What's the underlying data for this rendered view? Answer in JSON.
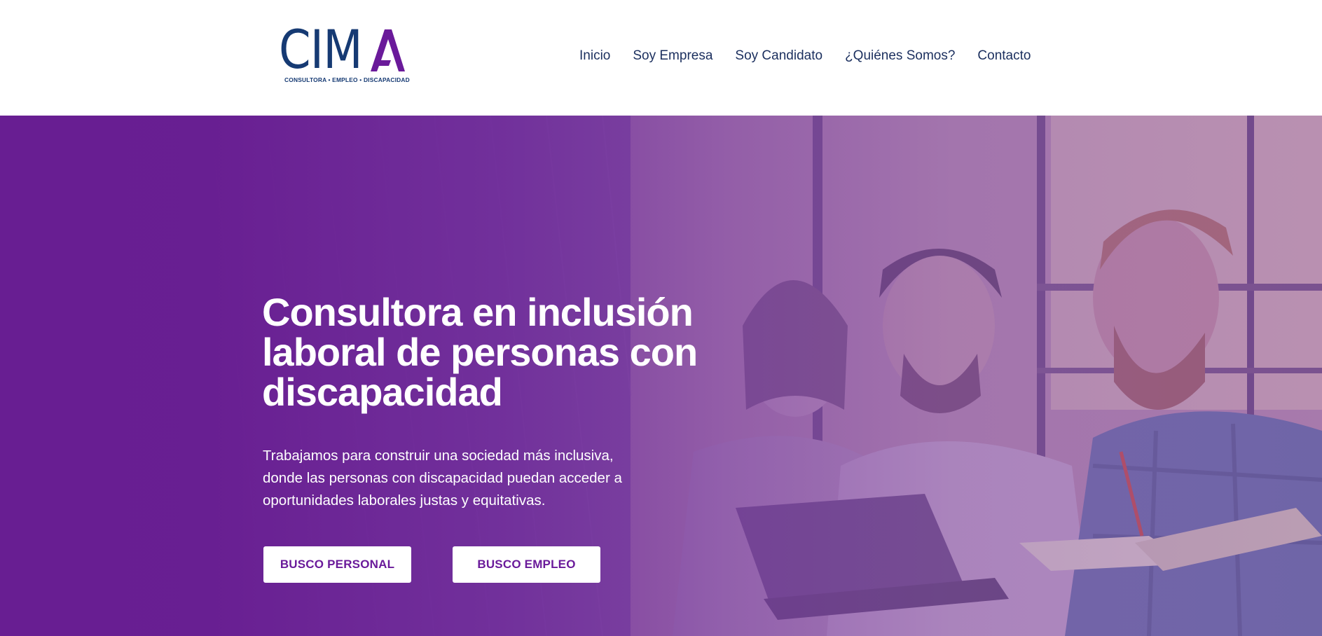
{
  "header": {
    "logo": {
      "letters": "CIM",
      "accent_letter": "A",
      "tagline": "CONSULTORA • EMPLEO • DISCAPACIDAD",
      "color_primary": "#163a73",
      "color_accent": "#6a1a9a"
    },
    "nav": [
      {
        "label": "Inicio"
      },
      {
        "label": "Soy Empresa"
      },
      {
        "label": "Soy Candidato"
      },
      {
        "label": "¿Quiénes Somos?"
      },
      {
        "label": "Contacto"
      }
    ]
  },
  "hero": {
    "title": "Consultora en inclusión laboral de personas con discapacidad",
    "description": "Trabajamos para construir una sociedad más inclusiva, donde las personas con discapacidad puedan acceder a oportunidades laborales justas y equitativas.",
    "buttons": {
      "personal": "BUSCO PERSONAL",
      "empleo": "BUSCO EMPLEO"
    },
    "overlay_color": "#6a1a9a",
    "background_image": "three-people-looking-at-laptop-photo"
  }
}
